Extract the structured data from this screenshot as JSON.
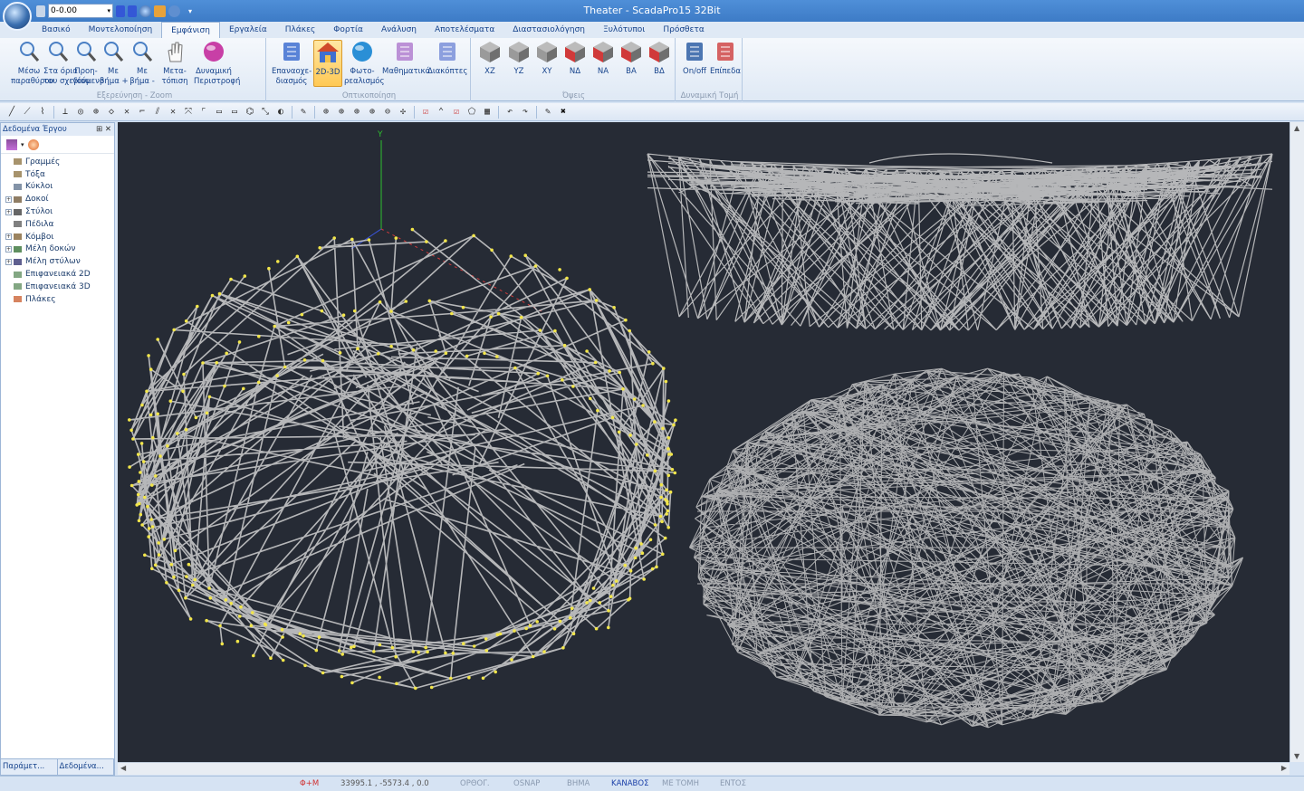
{
  "window": {
    "title": "Theater - ScadaPro15 32Bit"
  },
  "qat": {
    "combo_value": "0-0.00"
  },
  "tabs": [
    "Βασικό",
    "Μοντελοποίηση",
    "Εμφάνιση",
    "Εργαλεία",
    "Πλάκες",
    "Φορτία",
    "Ανάλυση",
    "Αποτελέσματα",
    "Διαστασιολόγηση",
    "Ξυλότυποι",
    "Πρόσθετα"
  ],
  "active_tab": "Εμφάνιση",
  "ribbon": {
    "zoom_group": {
      "label": "Εξερεύνηση - Zoom",
      "buttons": [
        {
          "label": "Μέσω\nπαραθύρου",
          "icon": "zoom-window-icon"
        },
        {
          "label": "Στα όρια\nτου σχεδίου",
          "icon": "zoom-extents-icon"
        },
        {
          "label": "Προη-\nγούμενο",
          "icon": "zoom-previous-icon"
        },
        {
          "label": "Με\nβήμα +",
          "icon": "zoom-in-icon"
        },
        {
          "label": "Με\nβήμα -",
          "icon": "zoom-out-icon"
        },
        {
          "label": "Μετα-\nτόπιση",
          "icon": "pan-hand-icon"
        },
        {
          "label": "Δυναμική\nΠεριστροφή",
          "icon": "orbit-icon"
        }
      ]
    },
    "render_group": {
      "label": "Οπτικοποίηση",
      "buttons": [
        {
          "label": "Επαναοχε-\nδιασμός",
          "icon": "redraw-icon"
        },
        {
          "label": "2D-3D",
          "icon": "house-3d-icon",
          "selected": true
        },
        {
          "label": "Φωτο-\nρεαλισμός",
          "icon": "photoreal-icon"
        },
        {
          "label": "Μαθηματικό",
          "icon": "math-model-icon"
        },
        {
          "label": "Διακόπτες",
          "icon": "switches-icon"
        }
      ]
    },
    "views_group": {
      "label": "Όψεις",
      "buttons": [
        {
          "label": "XZ",
          "icon": "cube-view-icon"
        },
        {
          "label": "YZ",
          "icon": "cube-view-icon"
        },
        {
          "label": "XY",
          "icon": "cube-view-icon"
        },
        {
          "label": "ΝΔ",
          "icon": "cube-view-icon"
        },
        {
          "label": "ΝΑ",
          "icon": "cube-view-icon"
        },
        {
          "label": "ΒΑ",
          "icon": "cube-view-icon"
        },
        {
          "label": "ΒΔ",
          "icon": "cube-view-icon"
        }
      ]
    },
    "section_group": {
      "label": "Δυναμική Τομή",
      "buttons": [
        {
          "label": "On/off",
          "icon": "section-onoff-icon"
        },
        {
          "label": "Επίπεδα",
          "icon": "section-planes-icon"
        }
      ]
    }
  },
  "panel": {
    "title": "Δεδομένα Έργου",
    "pin": "⊞",
    "close": "✕",
    "tree": [
      {
        "label": "Γραμμές",
        "expandable": false
      },
      {
        "label": "Τόξα",
        "expandable": false
      },
      {
        "label": "Κύκλοι",
        "expandable": false
      },
      {
        "label": "Δοκοί",
        "expandable": true
      },
      {
        "label": "Στύλοι",
        "expandable": true
      },
      {
        "label": "Πέδιλα",
        "expandable": false
      },
      {
        "label": "Κόμβοι",
        "expandable": true
      },
      {
        "label": "Μέλη δοκών",
        "expandable": true
      },
      {
        "label": "Μέλη στύλων",
        "expandable": true
      },
      {
        "label": "Επιφανειακά 2D",
        "expandable": false
      },
      {
        "label": "Επιφανειακά 3D",
        "expandable": false
      },
      {
        "label": "Πλάκες",
        "expandable": false
      }
    ],
    "bottom_tabs": [
      "Παράμετ...",
      "Δεδομένα..."
    ]
  },
  "viewport": {
    "axis_label": "Y",
    "background": "#262b35",
    "mesh_color": "#d0d0d0",
    "node_color": "#f2e64a"
  },
  "status": {
    "mode": "Φ+Μ",
    "coords": "33995.1 , -5573.4 , 0.0",
    "toggles": [
      {
        "label": "ΟΡΘΟΓ.",
        "active": false
      },
      {
        "label": "OSNAP",
        "active": false
      },
      {
        "label": "ΒΗΜΑ",
        "active": false
      },
      {
        "label": "ΚΑΝΑΒΟΣ",
        "active": true
      },
      {
        "label": "ΜΕ ΤΟΜΗ",
        "active": false
      },
      {
        "label": "ΕΝΤΟΣ",
        "active": false
      }
    ]
  }
}
